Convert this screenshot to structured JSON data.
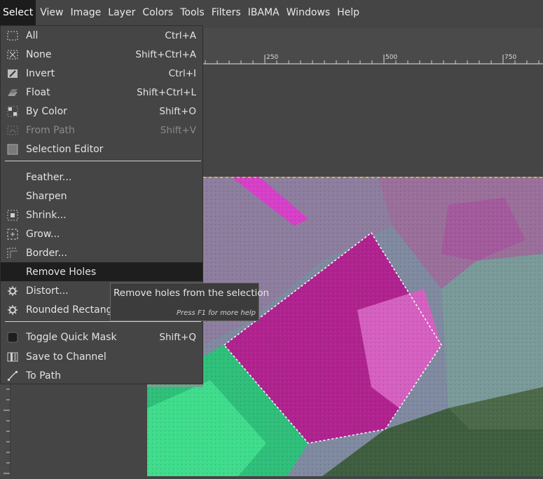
{
  "menubar": {
    "items": [
      "Select",
      "View",
      "Image",
      "Layer",
      "Colors",
      "Tools",
      "Filters",
      "IBAMA",
      "Windows",
      "Help"
    ]
  },
  "ruler": {
    "labels": [
      "250",
      "500",
      "750"
    ]
  },
  "select_menu": {
    "items": [
      {
        "label": "All",
        "shortcut": "Ctrl+A",
        "icon": "select-all-icon"
      },
      {
        "label": "None",
        "shortcut": "Shift+Ctrl+A",
        "icon": "select-none-icon"
      },
      {
        "label": "Invert",
        "shortcut": "Ctrl+I",
        "icon": "invert-selection-icon"
      },
      {
        "label": "Float",
        "shortcut": "Shift+Ctrl+L",
        "icon": "float-layer-icon"
      },
      {
        "label": "By Color",
        "shortcut": "Shift+O",
        "icon": "select-by-color-icon"
      },
      {
        "label": "From Path",
        "shortcut": "Shift+V",
        "icon": "from-path-icon"
      },
      {
        "label": "Selection Editor",
        "shortcut": "",
        "icon": "selection-editor-icon"
      },
      {
        "label": "Feather...",
        "shortcut": "",
        "icon": ""
      },
      {
        "label": "Sharpen",
        "shortcut": "",
        "icon": ""
      },
      {
        "label": "Shrink...",
        "shortcut": "",
        "icon": "shrink-icon"
      },
      {
        "label": "Grow...",
        "shortcut": "",
        "icon": "grow-icon"
      },
      {
        "label": "Border...",
        "shortcut": "",
        "icon": "border-icon"
      },
      {
        "label": "Remove Holes",
        "shortcut": "",
        "icon": ""
      },
      {
        "label": "Distort...",
        "shortcut": "",
        "icon": "gear-icon"
      },
      {
        "label": "Rounded Rectangle",
        "shortcut": "",
        "icon": "gear-icon"
      },
      {
        "label": "Toggle Quick Mask",
        "shortcut": "Shift+Q",
        "icon": "quick-mask-icon"
      },
      {
        "label": "Save to Channel",
        "shortcut": "",
        "icon": "channel-icon"
      },
      {
        "label": "To Path",
        "shortcut": "",
        "icon": "path-icon"
      }
    ]
  },
  "tooltip": {
    "text": "Remove holes from the selection",
    "help": "Press F1 for more help"
  },
  "colors": {
    "menubar_bg": "#454545",
    "highlight_bg": "#1e1e1e",
    "image_magenta": "#b2208f",
    "image_green": "#3ad38a"
  }
}
